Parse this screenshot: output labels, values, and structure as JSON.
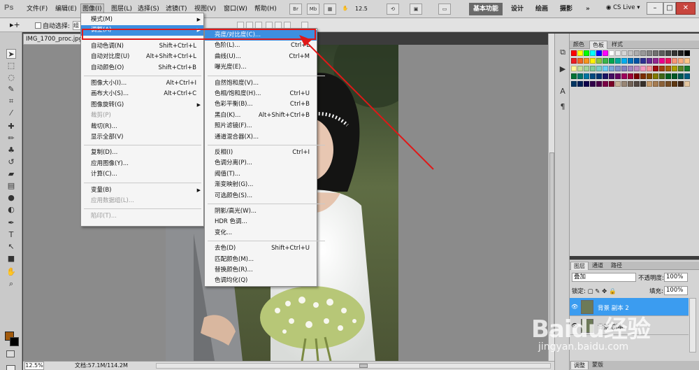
{
  "app": {
    "logo": "Ps"
  },
  "menubar": {
    "items": [
      "文件(F)",
      "编辑(E)",
      "图像(I)",
      "图层(L)",
      "选择(S)",
      "滤镜(T)",
      "视图(V)",
      "窗口(W)",
      "帮助(H)"
    ],
    "br_label": "Br",
    "mb_label": "Mb",
    "zoom": "12.5",
    "workspaces": [
      "基本功能",
      "设计",
      "绘画",
      "摄影"
    ],
    "overflow": "»",
    "cs_live": "CS Live"
  },
  "options": {
    "auto_select": "自动选择:",
    "group_value": "组"
  },
  "document": {
    "tab_title": "IMG_1700_proc.jpg",
    "zoom_status": "12.5%",
    "doc_info": "文档:57.1M/114.2M"
  },
  "image_menu": {
    "items": [
      {
        "label": "模式(M)",
        "arrow": true
      },
      {
        "label": "调整(A)",
        "arrow": true,
        "highlighted": true
      },
      {
        "sep": true
      },
      {
        "label": "自动色调(N)",
        "shortcut": "Shift+Ctrl+L"
      },
      {
        "label": "自动对比度(U)",
        "shortcut": "Alt+Shift+Ctrl+L"
      },
      {
        "label": "自动颜色(O)",
        "shortcut": "Shift+Ctrl+B"
      },
      {
        "sep": true
      },
      {
        "label": "图像大小(I)...",
        "shortcut": "Alt+Ctrl+I"
      },
      {
        "label": "画布大小(S)...",
        "shortcut": "Alt+Ctrl+C"
      },
      {
        "label": "图像旋转(G)",
        "arrow": true
      },
      {
        "label": "裁剪(P)",
        "disabled": true
      },
      {
        "label": "裁切(R)..."
      },
      {
        "label": "显示全部(V)"
      },
      {
        "sep": true
      },
      {
        "label": "复制(D)..."
      },
      {
        "label": "应用图像(Y)..."
      },
      {
        "label": "计算(C)..."
      },
      {
        "sep": true
      },
      {
        "label": "变量(B)",
        "arrow": true
      },
      {
        "label": "应用数据组(L)...",
        "disabled": true
      },
      {
        "sep": true
      },
      {
        "label": "陷印(T)...",
        "disabled": true
      }
    ]
  },
  "adjust_menu": {
    "items": [
      {
        "label": "亮度/对比度(C)...",
        "highlighted": true
      },
      {
        "label": "色阶(L)...",
        "shortcut": "Ctrl+L"
      },
      {
        "label": "曲线(U)...",
        "shortcut": "Ctrl+M"
      },
      {
        "label": "曝光度(E)..."
      },
      {
        "sep": true
      },
      {
        "label": "自然饱和度(V)..."
      },
      {
        "label": "色相/饱和度(H)...",
        "shortcut": "Ctrl+U"
      },
      {
        "label": "色彩平衡(B)...",
        "shortcut": "Ctrl+B"
      },
      {
        "label": "黑白(K)...",
        "shortcut": "Alt+Shift+Ctrl+B"
      },
      {
        "label": "照片滤镜(F)..."
      },
      {
        "label": "通道混合器(X)..."
      },
      {
        "sep": true
      },
      {
        "label": "反相(I)",
        "shortcut": "Ctrl+I"
      },
      {
        "label": "色调分离(P)..."
      },
      {
        "label": "阈值(T)..."
      },
      {
        "label": "渐变映射(G)..."
      },
      {
        "label": "可选颜色(S)..."
      },
      {
        "sep": true
      },
      {
        "label": "阴影/高光(W)..."
      },
      {
        "label": "HDR 色调..."
      },
      {
        "label": "变化..."
      },
      {
        "sep": true
      },
      {
        "label": "去色(D)",
        "shortcut": "Shift+Ctrl+U"
      },
      {
        "label": "匹配颜色(M)..."
      },
      {
        "label": "替换颜色(R)..."
      },
      {
        "label": "色调均化(Q)"
      }
    ]
  },
  "swatch_panel": {
    "tabs": [
      "颜色",
      "色板",
      "样式"
    ]
  },
  "layers_panel": {
    "tabs": [
      "图层",
      "通道",
      "路径"
    ],
    "blend_mode": "叠加",
    "opacity_label": "不透明度:",
    "opacity_value": "100%",
    "lock_label": "锁定:",
    "fill_label": "填充:",
    "fill_value": "100%",
    "layers": [
      {
        "name": "背景 副本 2",
        "selected": true
      },
      {
        "name": "背景 副本"
      }
    ]
  },
  "bottom_tabs": [
    "调整",
    "蒙版"
  ],
  "watermark": {
    "logo": "Baidu经验",
    "url": "jingyan.baidu.com"
  },
  "colors": {
    "highlight": "#3d8fe0",
    "annotation_red": "#e01818",
    "foreground": "#a25a0c",
    "background": "#000000"
  },
  "icons": [
    "move-tool-icon",
    "marquee-tool-icon",
    "lasso-tool-icon",
    "quick-select-icon",
    "crop-tool-icon",
    "eyedropper-icon",
    "healing-brush-icon",
    "brush-icon",
    "clone-stamp-icon",
    "history-brush-icon",
    "eraser-icon",
    "gradient-icon",
    "blur-icon",
    "dodge-icon",
    "pen-icon",
    "type-icon",
    "path-select-icon",
    "shape-icon",
    "hand-icon",
    "zoom-icon"
  ]
}
